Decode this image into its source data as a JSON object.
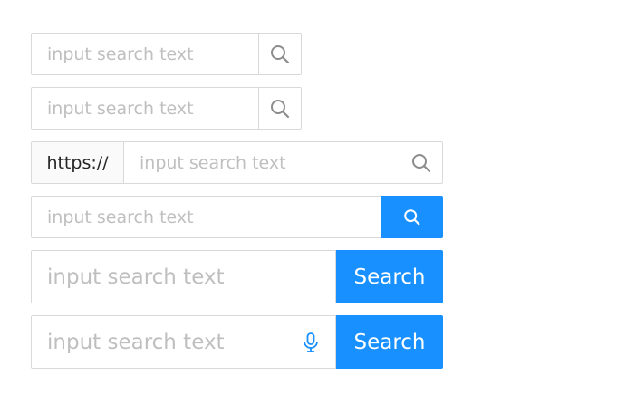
{
  "search_1": {
    "placeholder": "input search text",
    "button_icon": "search-icon"
  },
  "search_2": {
    "placeholder": "input search text",
    "button_icon": "search-icon"
  },
  "search_3": {
    "addon": "https://",
    "placeholder": "input search text",
    "button_icon": "search-icon"
  },
  "search_4": {
    "placeholder": "input search text",
    "button_icon": "search-icon"
  },
  "search_5": {
    "placeholder": "input search text",
    "button_label": "Search"
  },
  "search_6": {
    "placeholder": "input search text",
    "suffix_icon": "microphone-icon",
    "button_label": "Search"
  },
  "colors": {
    "primary": "#1890ff",
    "border": "#d9d9d9",
    "placeholder": "#bfbfbf",
    "icon": "#8c8c8c"
  }
}
